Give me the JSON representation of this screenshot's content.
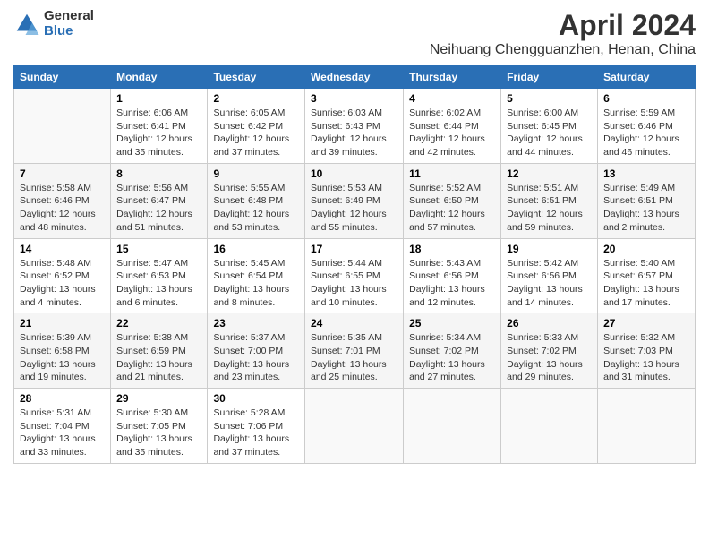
{
  "header": {
    "logo_general": "General",
    "logo_blue": "Blue",
    "title": "April 2024",
    "location": "Neihuang Chengguanzhen, Henan, China"
  },
  "weekdays": [
    "Sunday",
    "Monday",
    "Tuesday",
    "Wednesday",
    "Thursday",
    "Friday",
    "Saturday"
  ],
  "weeks": [
    [
      {
        "day": "",
        "sunrise": "",
        "sunset": "",
        "daylight": ""
      },
      {
        "day": "1",
        "sunrise": "Sunrise: 6:06 AM",
        "sunset": "Sunset: 6:41 PM",
        "daylight": "Daylight: 12 hours and 35 minutes."
      },
      {
        "day": "2",
        "sunrise": "Sunrise: 6:05 AM",
        "sunset": "Sunset: 6:42 PM",
        "daylight": "Daylight: 12 hours and 37 minutes."
      },
      {
        "day": "3",
        "sunrise": "Sunrise: 6:03 AM",
        "sunset": "Sunset: 6:43 PM",
        "daylight": "Daylight: 12 hours and 39 minutes."
      },
      {
        "day": "4",
        "sunrise": "Sunrise: 6:02 AM",
        "sunset": "Sunset: 6:44 PM",
        "daylight": "Daylight: 12 hours and 42 minutes."
      },
      {
        "day": "5",
        "sunrise": "Sunrise: 6:00 AM",
        "sunset": "Sunset: 6:45 PM",
        "daylight": "Daylight: 12 hours and 44 minutes."
      },
      {
        "day": "6",
        "sunrise": "Sunrise: 5:59 AM",
        "sunset": "Sunset: 6:46 PM",
        "daylight": "Daylight: 12 hours and 46 minutes."
      }
    ],
    [
      {
        "day": "7",
        "sunrise": "Sunrise: 5:58 AM",
        "sunset": "Sunset: 6:46 PM",
        "daylight": "Daylight: 12 hours and 48 minutes."
      },
      {
        "day": "8",
        "sunrise": "Sunrise: 5:56 AM",
        "sunset": "Sunset: 6:47 PM",
        "daylight": "Daylight: 12 hours and 51 minutes."
      },
      {
        "day": "9",
        "sunrise": "Sunrise: 5:55 AM",
        "sunset": "Sunset: 6:48 PM",
        "daylight": "Daylight: 12 hours and 53 minutes."
      },
      {
        "day": "10",
        "sunrise": "Sunrise: 5:53 AM",
        "sunset": "Sunset: 6:49 PM",
        "daylight": "Daylight: 12 hours and 55 minutes."
      },
      {
        "day": "11",
        "sunrise": "Sunrise: 5:52 AM",
        "sunset": "Sunset: 6:50 PM",
        "daylight": "Daylight: 12 hours and 57 minutes."
      },
      {
        "day": "12",
        "sunrise": "Sunrise: 5:51 AM",
        "sunset": "Sunset: 6:51 PM",
        "daylight": "Daylight: 12 hours and 59 minutes."
      },
      {
        "day": "13",
        "sunrise": "Sunrise: 5:49 AM",
        "sunset": "Sunset: 6:51 PM",
        "daylight": "Daylight: 13 hours and 2 minutes."
      }
    ],
    [
      {
        "day": "14",
        "sunrise": "Sunrise: 5:48 AM",
        "sunset": "Sunset: 6:52 PM",
        "daylight": "Daylight: 13 hours and 4 minutes."
      },
      {
        "day": "15",
        "sunrise": "Sunrise: 5:47 AM",
        "sunset": "Sunset: 6:53 PM",
        "daylight": "Daylight: 13 hours and 6 minutes."
      },
      {
        "day": "16",
        "sunrise": "Sunrise: 5:45 AM",
        "sunset": "Sunset: 6:54 PM",
        "daylight": "Daylight: 13 hours and 8 minutes."
      },
      {
        "day": "17",
        "sunrise": "Sunrise: 5:44 AM",
        "sunset": "Sunset: 6:55 PM",
        "daylight": "Daylight: 13 hours and 10 minutes."
      },
      {
        "day": "18",
        "sunrise": "Sunrise: 5:43 AM",
        "sunset": "Sunset: 6:56 PM",
        "daylight": "Daylight: 13 hours and 12 minutes."
      },
      {
        "day": "19",
        "sunrise": "Sunrise: 5:42 AM",
        "sunset": "Sunset: 6:56 PM",
        "daylight": "Daylight: 13 hours and 14 minutes."
      },
      {
        "day": "20",
        "sunrise": "Sunrise: 5:40 AM",
        "sunset": "Sunset: 6:57 PM",
        "daylight": "Daylight: 13 hours and 17 minutes."
      }
    ],
    [
      {
        "day": "21",
        "sunrise": "Sunrise: 5:39 AM",
        "sunset": "Sunset: 6:58 PM",
        "daylight": "Daylight: 13 hours and 19 minutes."
      },
      {
        "day": "22",
        "sunrise": "Sunrise: 5:38 AM",
        "sunset": "Sunset: 6:59 PM",
        "daylight": "Daylight: 13 hours and 21 minutes."
      },
      {
        "day": "23",
        "sunrise": "Sunrise: 5:37 AM",
        "sunset": "Sunset: 7:00 PM",
        "daylight": "Daylight: 13 hours and 23 minutes."
      },
      {
        "day": "24",
        "sunrise": "Sunrise: 5:35 AM",
        "sunset": "Sunset: 7:01 PM",
        "daylight": "Daylight: 13 hours and 25 minutes."
      },
      {
        "day": "25",
        "sunrise": "Sunrise: 5:34 AM",
        "sunset": "Sunset: 7:02 PM",
        "daylight": "Daylight: 13 hours and 27 minutes."
      },
      {
        "day": "26",
        "sunrise": "Sunrise: 5:33 AM",
        "sunset": "Sunset: 7:02 PM",
        "daylight": "Daylight: 13 hours and 29 minutes."
      },
      {
        "day": "27",
        "sunrise": "Sunrise: 5:32 AM",
        "sunset": "Sunset: 7:03 PM",
        "daylight": "Daylight: 13 hours and 31 minutes."
      }
    ],
    [
      {
        "day": "28",
        "sunrise": "Sunrise: 5:31 AM",
        "sunset": "Sunset: 7:04 PM",
        "daylight": "Daylight: 13 hours and 33 minutes."
      },
      {
        "day": "29",
        "sunrise": "Sunrise: 5:30 AM",
        "sunset": "Sunset: 7:05 PM",
        "daylight": "Daylight: 13 hours and 35 minutes."
      },
      {
        "day": "30",
        "sunrise": "Sunrise: 5:28 AM",
        "sunset": "Sunset: 7:06 PM",
        "daylight": "Daylight: 13 hours and 37 minutes."
      },
      {
        "day": "",
        "sunrise": "",
        "sunset": "",
        "daylight": ""
      },
      {
        "day": "",
        "sunrise": "",
        "sunset": "",
        "daylight": ""
      },
      {
        "day": "",
        "sunrise": "",
        "sunset": "",
        "daylight": ""
      },
      {
        "day": "",
        "sunrise": "",
        "sunset": "",
        "daylight": ""
      }
    ]
  ]
}
